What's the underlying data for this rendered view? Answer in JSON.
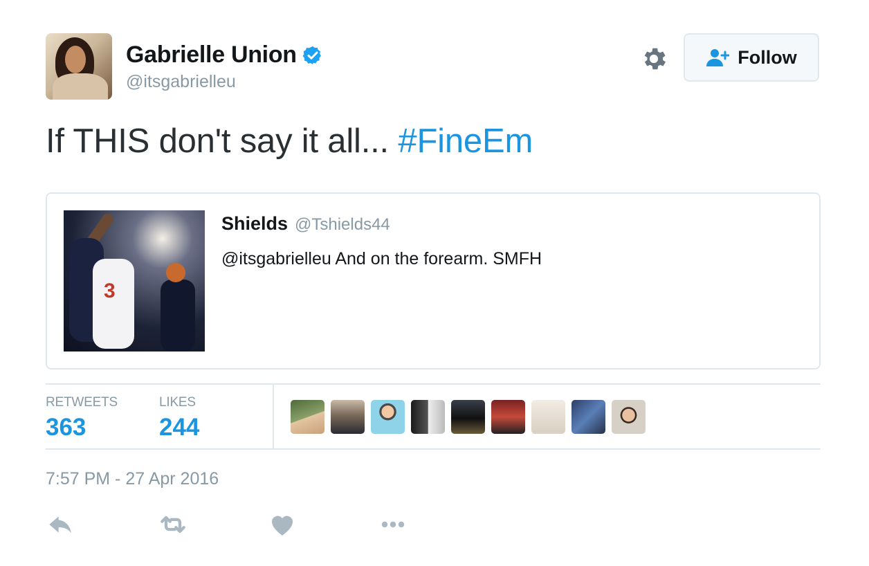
{
  "author": {
    "name": "Gabrielle Union",
    "handle": "@itsgabrielleu",
    "verified": true
  },
  "header": {
    "follow_label": "Follow",
    "settings_icon": "gear-icon",
    "follow_icon": "add-user-icon"
  },
  "tweet": {
    "text": "If THIS don't say it all... ",
    "hashtag": "#FineEm"
  },
  "quoted": {
    "name": "Shields",
    "handle": "@Tshields44",
    "text": "@itsgabrielleu And on the forearm. SMFH"
  },
  "stats": {
    "retweets_label": "RETWEETS",
    "retweets_value": "363",
    "likes_label": "LIKES",
    "likes_value": "244"
  },
  "timestamp": "7:57 PM - 27 Apr 2016",
  "actions": [
    "reply-icon",
    "retweet-icon",
    "like-icon",
    "more-icon"
  ],
  "colors": {
    "link": "#1b95e0",
    "muted": "#8899a6",
    "border": "#e1e8ed",
    "verified": "#1da1f2",
    "icon": "#aab8c2"
  }
}
